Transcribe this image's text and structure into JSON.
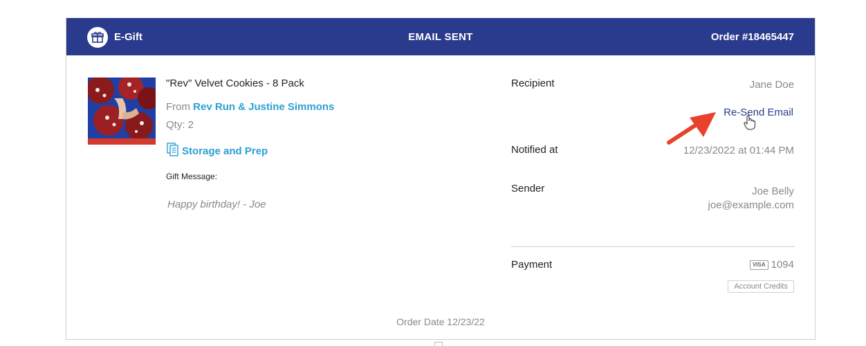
{
  "header": {
    "brand": "E-Gift",
    "status": "EMAIL SENT",
    "order": "Order #18465447",
    "logo_icon": "gift-icon",
    "color": "#2a3a8c"
  },
  "product": {
    "name": "\"Rev\" Velvet Cookies - 8 Pack",
    "from_prefix": "From",
    "from_name": "Rev Run & Justine Simmons",
    "qty": "Qty: 2",
    "storage_link": "Storage and Prep",
    "storage_icon": "document-icon"
  },
  "gift": {
    "label": "Gift Message:",
    "message": "Happy birthday! - Joe"
  },
  "recipient": {
    "label": "Recipient",
    "name": "Jane Doe",
    "resend_label": "Re-Send Email"
  },
  "notified": {
    "label": "Notified at",
    "value": "12/23/2022 at 01:44 PM"
  },
  "sender": {
    "label": "Sender",
    "name": "Joe Belly",
    "email": "joe@example.com"
  },
  "payment": {
    "label": "Payment",
    "card_brand": "VISA",
    "card_last4": "1094",
    "credits_badge": "Account Credits"
  },
  "order_date": "Order Date 12/23/22",
  "colors": {
    "accent": "#2aa0d4",
    "annotation_arrow": "#e8412c"
  }
}
